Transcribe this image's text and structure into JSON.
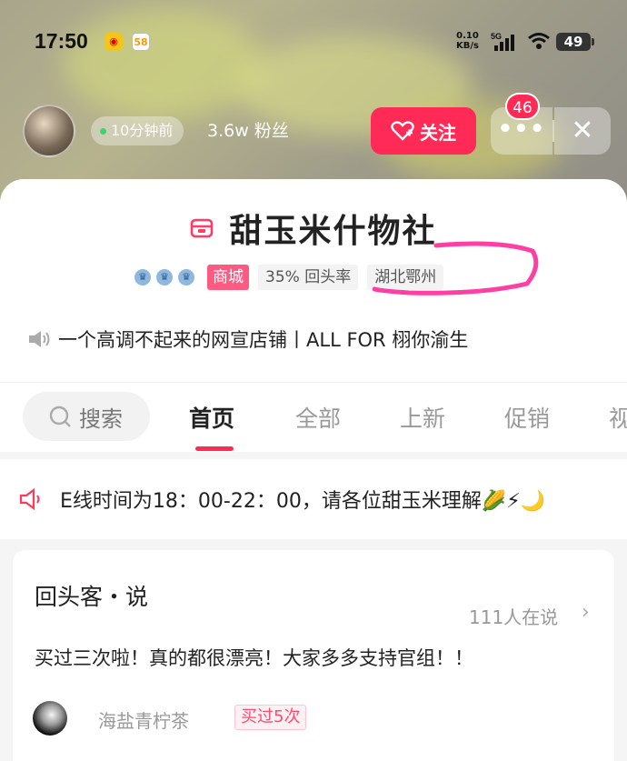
{
  "status_bar": {
    "time": "17:50",
    "app_icons": [
      "weibo-icon",
      "58-icon"
    ],
    "app_58_label": "58",
    "net_speed_value": "0.10",
    "net_speed_unit": "KB/s",
    "network": "5G",
    "battery": "49"
  },
  "shop_header": {
    "online_status": "10分钟前",
    "followers": "3.6w 粉丝",
    "follow_label": "关注",
    "notification_count": "46",
    "more_label": "•••",
    "close_label": "✕"
  },
  "shop": {
    "name": "甜玉米什物社",
    "level_icons": [
      "crown-icon",
      "crown-icon",
      "crown-icon"
    ],
    "tag_mall": "商城",
    "repurchase_rate": "35% 回头率",
    "location": "湖北鄂州",
    "slogan": "一个高调不起来的网宣店铺丨ALL FOR 栩你渝生"
  },
  "tabs": {
    "search_label": "搜索",
    "items": [
      "首页",
      "全部",
      "上新",
      "促销",
      "视"
    ],
    "active_index": 0
  },
  "notice": {
    "text": "E线时间为18：00-22：00，请各位甜玉米理解🌽⚡🌙"
  },
  "review_section": {
    "title": "回头客・说",
    "count": "111人在说",
    "chevron": "›",
    "text": "买过三次啦！真的都很漂亮！大家多多支持官组！！",
    "reviewer_name": "海盐青柠茶",
    "bought_tag": "买过5次"
  },
  "colors": {
    "accent": "#ff2a55",
    "mall_tag": "#ff5a82",
    "highlight_stroke": "#ff3fa4"
  }
}
